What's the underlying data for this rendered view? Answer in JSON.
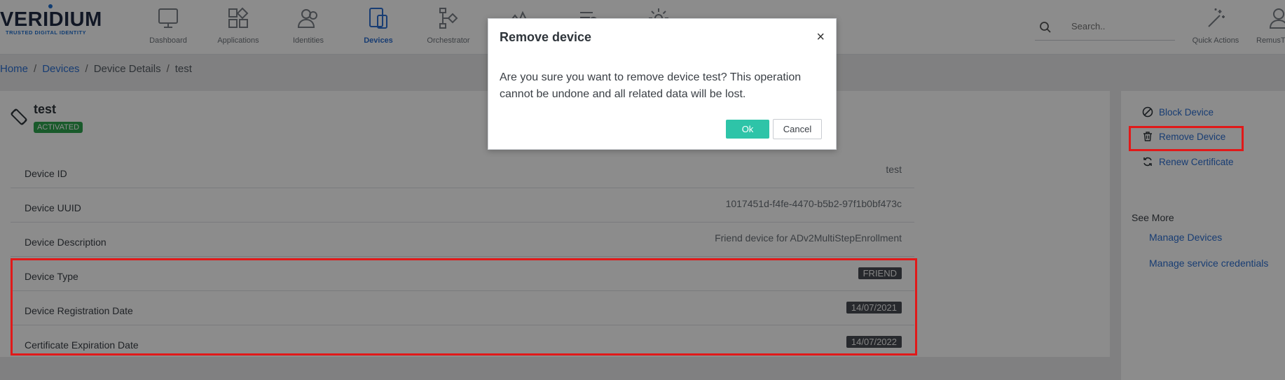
{
  "logo": {
    "main": "VERIDIUM",
    "sub": "TRUSTED DIGITAL IDENTITY"
  },
  "nav": {
    "items": [
      {
        "label": "Dashboard",
        "icon": "monitor-icon"
      },
      {
        "label": "Applications",
        "icon": "apps-grid-icon"
      },
      {
        "label": "Identities",
        "icon": "users-icon"
      },
      {
        "label": "Devices",
        "icon": "devices-icon",
        "active": true
      },
      {
        "label": "Orchestrator",
        "icon": "flow-icon"
      },
      {
        "label": "",
        "icon": "chart-icon"
      },
      {
        "label": "",
        "icon": "list-icon"
      },
      {
        "label": "",
        "icon": "gear-icon"
      }
    ]
  },
  "search": {
    "placeholder": "Search.."
  },
  "quick_actions": {
    "label": "Quick Actions"
  },
  "user": {
    "label": "RemusT"
  },
  "breadcrumb": {
    "home": "Home",
    "devices": "Devices",
    "details": "Device Details",
    "current": "test",
    "sep": "/"
  },
  "device": {
    "name": "test",
    "status": "ACTIVATED",
    "rows": [
      {
        "key": "Device ID",
        "value": "test"
      },
      {
        "key": "Device UUID",
        "value": "1017451d-f4fe-4470-b5b2-97f1b0bf473c"
      },
      {
        "key": "Device Description",
        "value": "Friend device for ADv2MultiStepEnrollment"
      },
      {
        "key": "Device Type",
        "value": "FRIEND"
      },
      {
        "key": "Device Registration Date",
        "value": "14/07/2021"
      },
      {
        "key": "Certificate Expiration Date",
        "value": "14/07/2022"
      }
    ]
  },
  "side": {
    "block": "Block Device",
    "remove": "Remove Device",
    "renew": "Renew Certificate",
    "see_more": "See More",
    "manage_devices": "Manage Devices",
    "manage_credentials": "Manage service credentials"
  },
  "modal": {
    "title": "Remove device",
    "close": "×",
    "body": "Are you sure you want to remove device test? This operation cannot be undone and all related data will be lost.",
    "ok": "Ok",
    "cancel": "Cancel"
  },
  "colors": {
    "accent": "#2d6fd2",
    "ok": "#2ec4a8",
    "highlight": "#e11919",
    "activated": "#2ea44f"
  }
}
